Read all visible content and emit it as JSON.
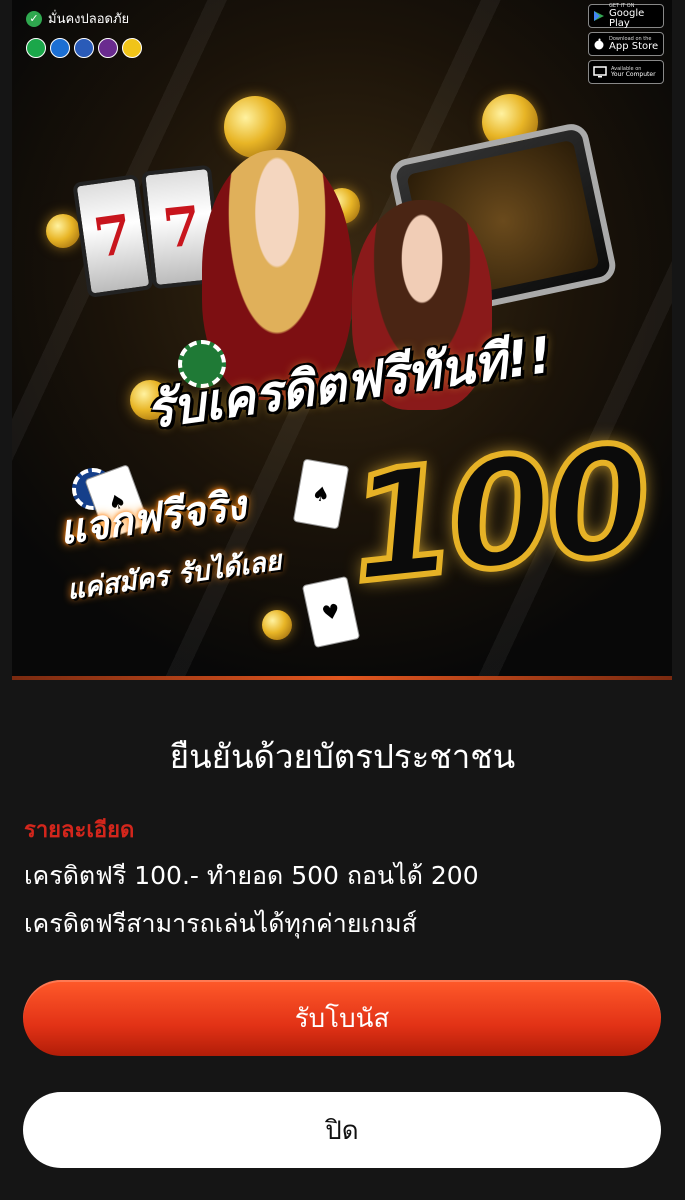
{
  "banner": {
    "trust_label": "มั่นคงปลอดภัย",
    "bank_colors": [
      "#1ba74a",
      "#1c6fd3",
      "#2a5bb8",
      "#6a2b8f",
      "#f0c419"
    ],
    "stores": [
      {
        "small": "GET IT ON",
        "big": "Google Play",
        "icon": "play-icon"
      },
      {
        "small": "Download on the",
        "big": "App Store",
        "icon": "apple-icon"
      },
      {
        "small": "Available on",
        "big": "Your Computer",
        "icon": "monitor-icon"
      }
    ],
    "headline": "รับเครดิตฟรีทันที!!",
    "sub_headline": "แจกฟรีจริง",
    "sub_line": "แค่สมัคร รับได้เลย",
    "amount": "100"
  },
  "dialog": {
    "title": "ยืนยันด้วยบัตรประชาชน",
    "detail_label": "รายละเอียด",
    "detail_line_1": "เครดิตฟรี 100.- ทำยอด 500 ถอนได้ 200",
    "detail_line_2": "เครดิตฟรีสามารถเล่นได้ทุกค่ายเกมส์",
    "claim_button": "รับโบนัส",
    "close_button": "ปิด"
  },
  "colors": {
    "accent": "#e23216",
    "detail_label": "#d3261c",
    "background": "#151515"
  }
}
